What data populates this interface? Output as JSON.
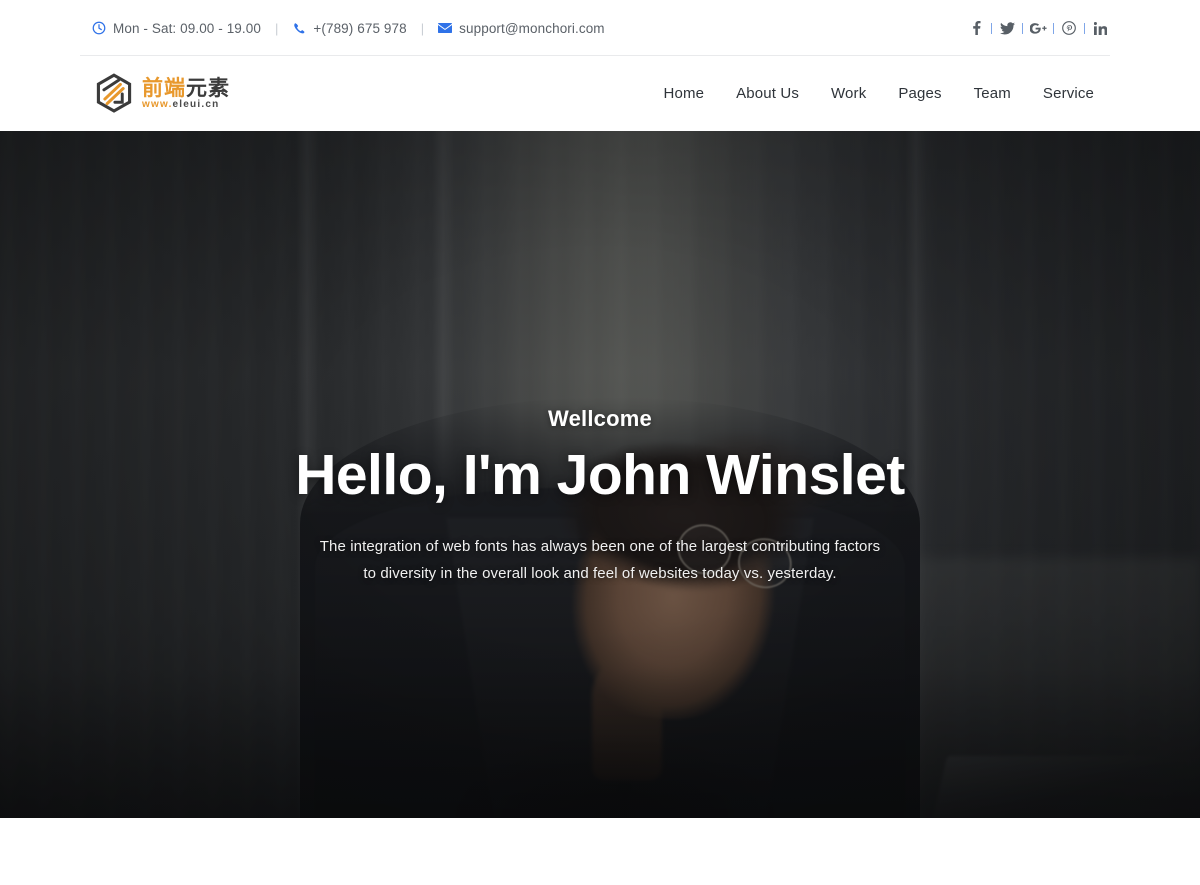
{
  "topbar": {
    "hours": {
      "icon": "clock-icon",
      "text": "Mon - Sat: 09.00 - 19.00"
    },
    "phone": {
      "icon": "phone-icon",
      "text": "+(789) 675 978"
    },
    "email": {
      "icon": "envelope-icon",
      "text": "support@monchori.com"
    },
    "separator": "|",
    "social": [
      {
        "name": "facebook",
        "label": "f"
      },
      {
        "name": "twitter",
        "label": "t"
      },
      {
        "name": "google-plus",
        "label": "G+"
      },
      {
        "name": "pinterest",
        "label": "P"
      },
      {
        "name": "linkedin",
        "label": "in"
      }
    ],
    "colors": {
      "icon_blue": "#2f72e8",
      "separator_blue": "#7fa6e8",
      "text": "#5b6168"
    }
  },
  "brand": {
    "cn_orange": "前端",
    "cn_dark": "元素",
    "url_orange": "www.",
    "url_dark": "eleui.cn",
    "colors": {
      "orange": "#e8982c",
      "dark": "#3b3b3b"
    }
  },
  "nav": {
    "items": [
      {
        "label": "Home"
      },
      {
        "label": "About Us"
      },
      {
        "label": "Work"
      },
      {
        "label": "Pages"
      },
      {
        "label": "Team"
      },
      {
        "label": "Service"
      }
    ]
  },
  "hero": {
    "subtitle": "Wellcome",
    "title": "Hello, I'm John Winslet",
    "paragraph_line1": "The integration of web fonts has always been one of the largest contributing factors",
    "paragraph_line2": "to diversity in the overall look and feel of websites today vs. yesterday.",
    "background_description": "Dark-toned photo of a man in a suit with glasses looking down, seated in a room with light curtains"
  }
}
